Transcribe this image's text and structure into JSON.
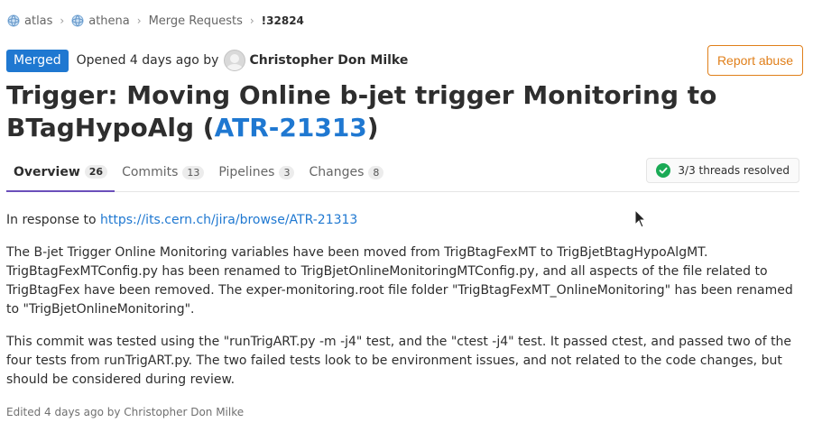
{
  "breadcrumb": {
    "items": [
      {
        "label": "atlas",
        "icon": "project-icon"
      },
      {
        "label": "athena",
        "icon": "project-icon"
      },
      {
        "label": "Merge Requests"
      },
      {
        "label": "!32824"
      }
    ],
    "separator": "›"
  },
  "header": {
    "status": "Merged",
    "opened_text": "Opened 4 days ago by",
    "author": "Christopher Don Milke",
    "report_label": "Report abuse"
  },
  "title": {
    "text_before": "Trigger: Moving Online b-jet trigger Monitoring to BTagHypoAlg (",
    "link": "ATR-21313",
    "text_after": ")"
  },
  "tabs": [
    {
      "label": "Overview",
      "count": "26",
      "active": true
    },
    {
      "label": "Commits",
      "count": "13"
    },
    {
      "label": "Pipelines",
      "count": "3"
    },
    {
      "label": "Changes",
      "count": "8"
    }
  ],
  "threads": {
    "label": "3/3 threads resolved",
    "icon": "check-circle-icon"
  },
  "description": {
    "p1_prefix": "In response to ",
    "p1_link": "https://its.cern.ch/jira/browse/ATR-21313",
    "p2": "The B-jet Trigger Online Monitoring variables have been moved from TrigBtagFexMT to TrigBjetBtagHypoAlgMT. TrigBtagFexMTConfig.py has been renamed to TrigBjetOnlineMonitoringMTConfig.py, and all aspects of the file related to TrigBtagFex have been removed. The exper-monitoring.root file folder \"TrigBtagFexMT_OnlineMonitoring\" has been renamed to \"TrigBjetOnlineMonitoring\".",
    "p3": "This commit was tested using the \"runTrigART.py -m -j4\" test, and the \"ctest -j4\" test. It passed ctest, and passed two of the four tests from runTrigART.py. The two failed tests look to be environment issues, and not related to the code changes, but should be considered during review."
  },
  "edited": "Edited 4 days ago by Christopher Don Milke",
  "colors": {
    "accent": "#1f78d1",
    "report": "#e07f1a",
    "tab_active": "#6b4fbb",
    "resolved": "#1aaa55"
  }
}
